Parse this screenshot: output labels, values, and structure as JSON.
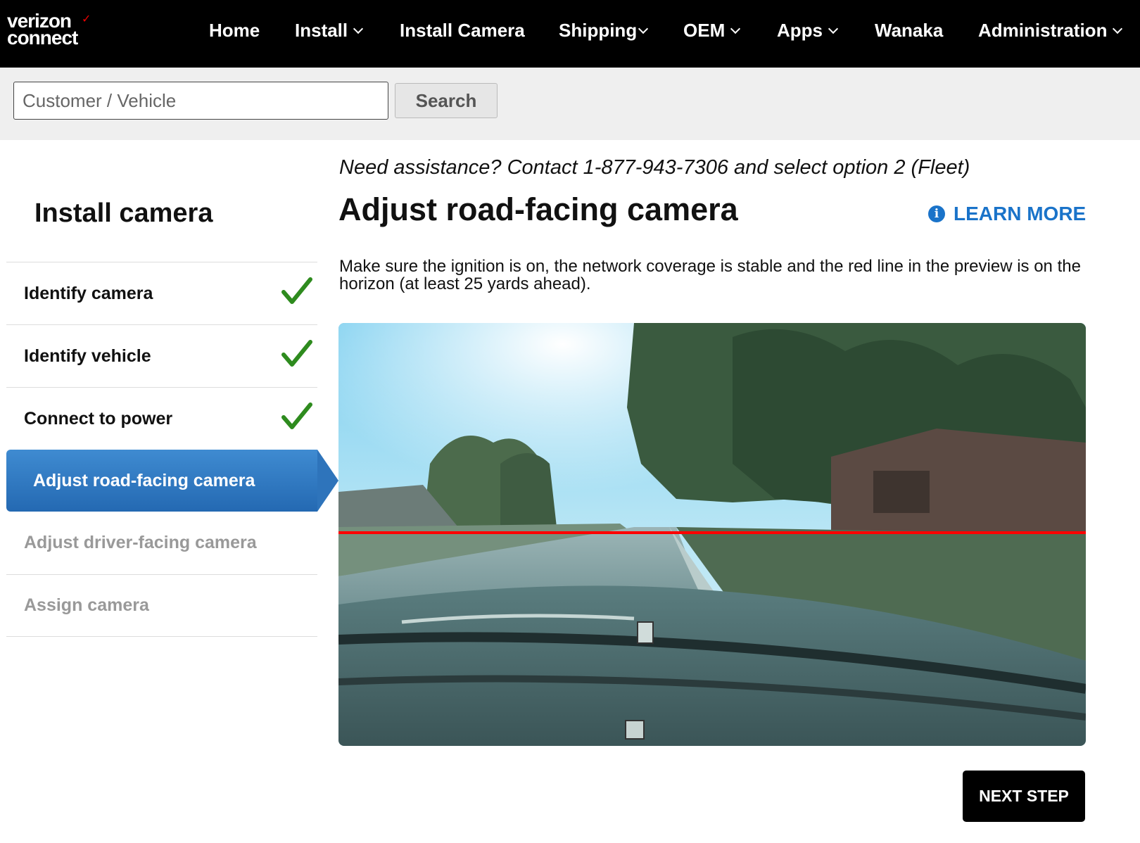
{
  "brand": {
    "line1": "verizon",
    "line2": "connect"
  },
  "nav": {
    "items": [
      {
        "label": "Home"
      },
      {
        "label": "Install"
      },
      {
        "label": "Install Camera"
      },
      {
        "label": "Shipping"
      },
      {
        "label": "OEM"
      },
      {
        "label": "Apps"
      },
      {
        "label": "Wanaka"
      },
      {
        "label": "Administration"
      }
    ]
  },
  "search": {
    "placeholder": "Customer / Vehicle",
    "value": "",
    "button_label": "Search"
  },
  "sidebar": {
    "title": "Install camera",
    "steps": [
      {
        "label": "Identify camera",
        "state": "complete"
      },
      {
        "label": "Identify vehicle",
        "state": "complete"
      },
      {
        "label": "Connect to power",
        "state": "complete"
      },
      {
        "label": "Adjust road-facing camera",
        "state": "active"
      },
      {
        "label": "Adjust driver-facing camera",
        "state": "disabled"
      },
      {
        "label": "Assign camera",
        "state": "disabled"
      }
    ]
  },
  "main": {
    "assistance": "Need assistance? Contact 1-877-943-7306 and select option 2 (Fleet)",
    "title": "Adjust road-facing camera",
    "learn_more": "LEARN MORE",
    "instructions": "Make sure the ignition is on, the network coverage is stable and the red line in the preview is on the horizon (at least 25 yards ahead).",
    "next_button": "NEXT STEP"
  },
  "colors": {
    "nav_bg": "#000000",
    "active_step": "#2e74bb",
    "check": "#2e8b1e",
    "link": "#1a73c9",
    "horizon_line": "#ff0000"
  },
  "icons": {
    "step_complete": "check-icon",
    "learn_more": "info-icon",
    "dropdown": "chevron-down-icon"
  }
}
